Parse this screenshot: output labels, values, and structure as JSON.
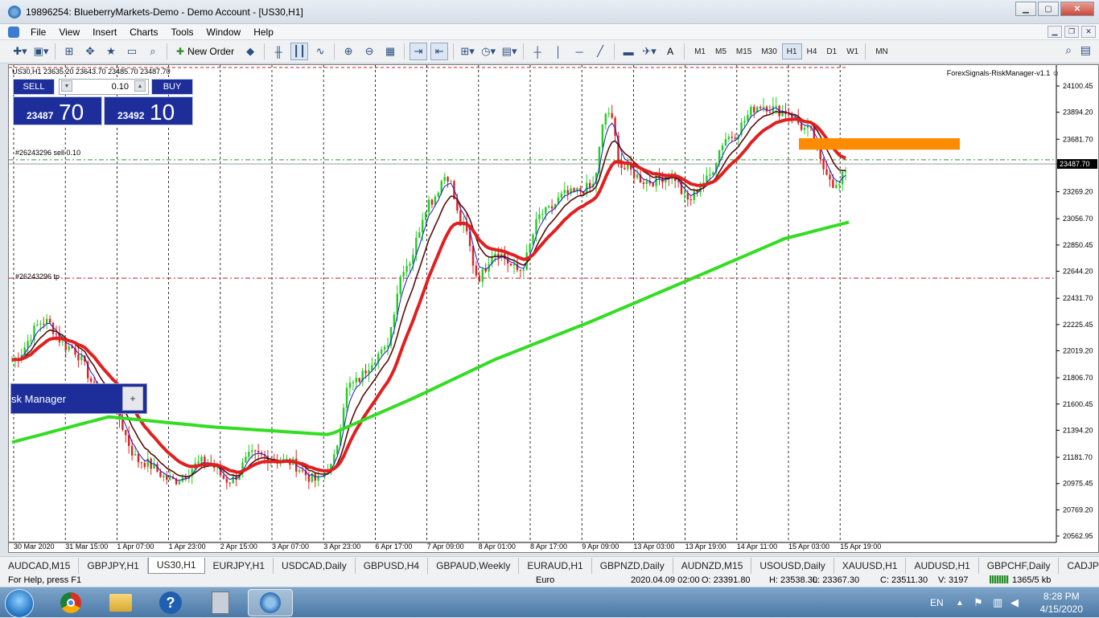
{
  "window": {
    "title": "19896254: BlueberryMarkets-Demo - Demo Account - [US30,H1]"
  },
  "menu": [
    "File",
    "View",
    "Insert",
    "Charts",
    "Tools",
    "Window",
    "Help"
  ],
  "toolbar": {
    "new_order_label": "New Order",
    "timeframes": [
      "M1",
      "M5",
      "M15",
      "M30",
      "H1",
      "H4",
      "D1",
      "W1",
      "MN"
    ],
    "active_timeframe": "H1"
  },
  "chart": {
    "symbol_info": "US30,H1  23635.20 23643.70 23485.70 23487.70",
    "ea_name": "ForexSignals-RiskManager-v1.1 ☺",
    "sell_order_label": "#26243296 sell 0.10",
    "tp_label": "#26243296 tp",
    "current_price": "23487.70",
    "price_axis": [
      "24100.45",
      "23894.20",
      "23681.70",
      "23487.70",
      "23269.20",
      "23056.70",
      "22850.45",
      "22644.20",
      "22431.70",
      "22225.45",
      "22019.20",
      "21806.70",
      "21600.45",
      "21394.20",
      "21181.70",
      "20975.45",
      "20769.20",
      "20562.95"
    ],
    "time_axis": [
      "30 Mar 2020",
      "31 Mar 15:00",
      "1 Apr 07:00",
      "1 Apr 23:00",
      "2 Apr 15:00",
      "3 Apr 07:00",
      "3 Apr 23:00",
      "6 Apr 17:00",
      "7 Apr 09:00",
      "8 Apr 01:00",
      "8 Apr 17:00",
      "9 Apr 09:00",
      "13 Apr 03:00",
      "13 Apr 19:00",
      "14 Apr 11:00",
      "15 Apr 03:00",
      "15 Apr 19:00"
    ],
    "colors": {
      "bull": "#22cc22",
      "bear": "#dd2222",
      "ma_fast": "#1a1acc",
      "ma_mid": "#5a0e0e",
      "ma_slow": "#e02020",
      "ma_long": "#33dd22",
      "zone": "#ff8c00"
    }
  },
  "trade_panel": {
    "sell_label": "SELL",
    "buy_label": "BUY",
    "lot": "0.10",
    "sell_price_main": "23487",
    "sell_price_pips": "70",
    "buy_price_main": "23492",
    "buy_price_pips": "10"
  },
  "risk_manager": {
    "label": "sk Manager",
    "plus": "+"
  },
  "tabs": [
    "AUDCAD,M15",
    "GBPJPY,H1",
    "US30,H1",
    "EURJPY,H1",
    "USDCAD,Daily",
    "GBPUSD,H4",
    "GBPAUD,Weekly",
    "EURAUD,H1",
    "GBPNZD,Daily",
    "AUDNZD,M15",
    "USOUSD,Daily",
    "XAUUSD,H1",
    "AUDUSD,H1",
    "GBPCHF,Daily",
    "CADJPY,Da"
  ],
  "active_tab": "US30,H1",
  "status": {
    "help": "For Help, press F1",
    "profile": "Euro",
    "datetime": "2020.04.09 02:00",
    "open": "O: 23391.80",
    "high": "H: 23538.30",
    "low": "L: 23367.30",
    "close": "C: 23511.30",
    "volume": "V: 3197",
    "traffic": "1365/5 kb"
  },
  "taskbar": {
    "lang": "EN",
    "time": "8:28 PM",
    "date": "4/15/2020"
  }
}
